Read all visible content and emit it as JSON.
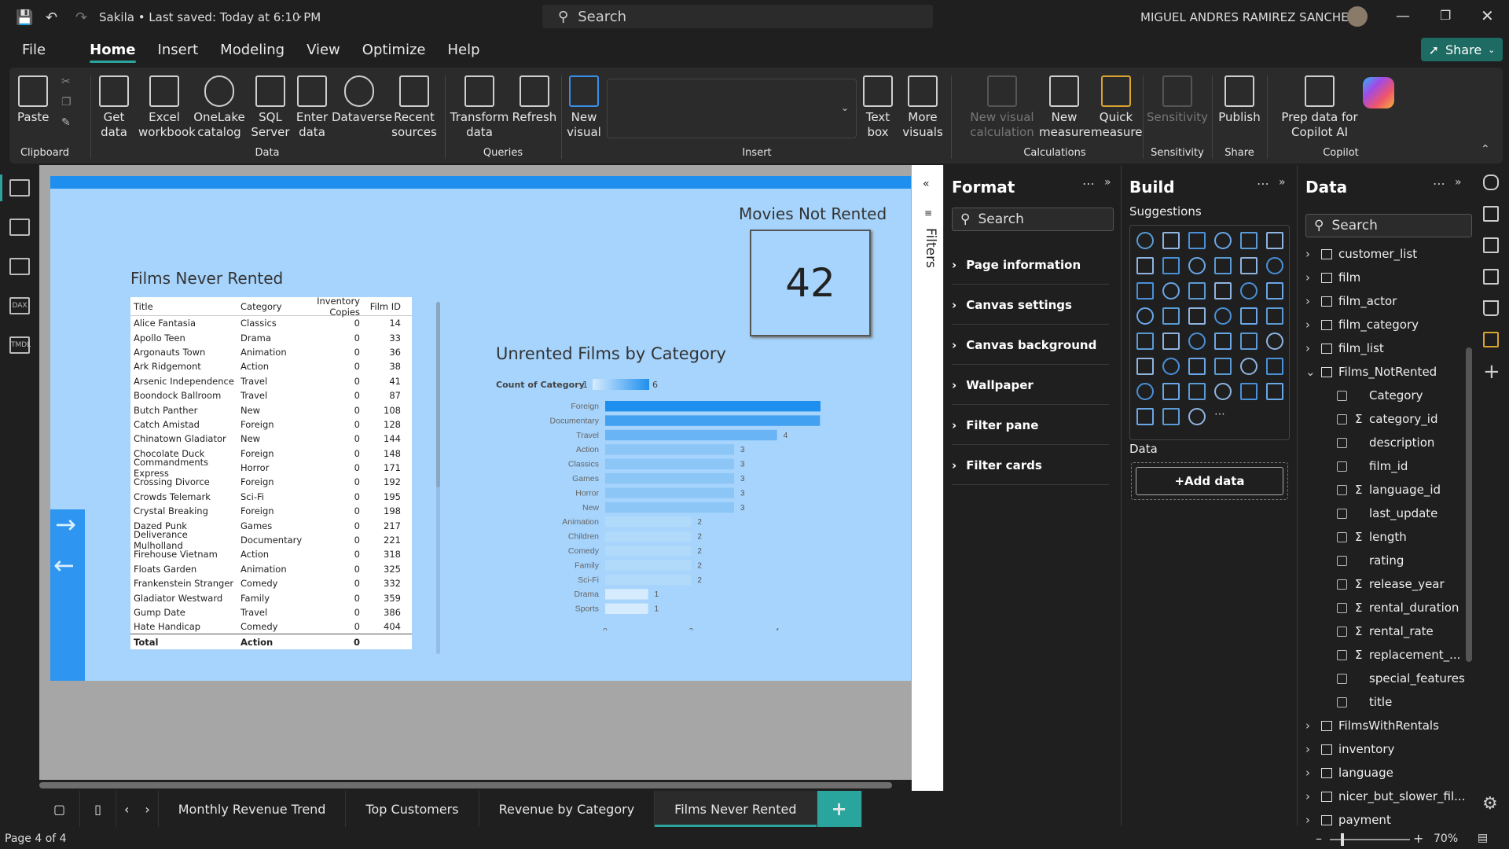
{
  "titlebar": {
    "title": "Sakila • Last saved: Today at 6:10 PM",
    "search": "Search",
    "user": "MIGUEL ANDRES RAMIREZ SANCHEZ"
  },
  "menu": [
    "File",
    "Home",
    "Insert",
    "Modeling",
    "View",
    "Optimize",
    "Help"
  ],
  "share": "Share",
  "ribbon": {
    "paste": "Paste",
    "get_data": "Get data",
    "excel": "Excel workbook",
    "onelake": "OneLake catalog",
    "sql": "SQL Server",
    "enter_data": "Enter data",
    "dataverse": "Dataverse",
    "recent": "Recent sources",
    "transform": "Transform data",
    "refresh": "Refresh",
    "new_visual": "New visual",
    "text_box": "Text box",
    "more_visuals": "More visuals",
    "new_visual_calc": "New visual calculation",
    "new_measure": "New measure",
    "quick_measure": "Quick measure",
    "sensitivity": "Sensitivity",
    "publish": "Publish",
    "prep_copilot": "Prep data for Copilot AI",
    "copilot": "Copilot",
    "groups": {
      "clipboard": "Clipboard",
      "data": "Data",
      "queries": "Queries",
      "insert": "Insert",
      "calculations": "Calculations",
      "sensitivity": "Sensitivity",
      "share": "Share",
      "copilot": "Copilot"
    }
  },
  "report": {
    "card_title": "Movies Not Rented",
    "card_value": "42",
    "table_title": "Films Never Rented",
    "table_headers": [
      "Title",
      "Category",
      "Inventory Copies",
      "Film ID"
    ],
    "table_rows": [
      [
        "Alice Fantasia",
        "Classics",
        "0",
        "14"
      ],
      [
        "Apollo Teen",
        "Drama",
        "0",
        "33"
      ],
      [
        "Argonauts Town",
        "Animation",
        "0",
        "36"
      ],
      [
        "Ark Ridgemont",
        "Action",
        "0",
        "38"
      ],
      [
        "Arsenic Independence",
        "Travel",
        "0",
        "41"
      ],
      [
        "Boondock Ballroom",
        "Travel",
        "0",
        "87"
      ],
      [
        "Butch Panther",
        "New",
        "0",
        "108"
      ],
      [
        "Catch Amistad",
        "Foreign",
        "0",
        "128"
      ],
      [
        "Chinatown Gladiator",
        "New",
        "0",
        "144"
      ],
      [
        "Chocolate Duck",
        "Foreign",
        "0",
        "148"
      ],
      [
        "Commandments Express",
        "Horror",
        "0",
        "171"
      ],
      [
        "Crossing Divorce",
        "Foreign",
        "0",
        "192"
      ],
      [
        "Crowds Telemark",
        "Sci-Fi",
        "0",
        "195"
      ],
      [
        "Crystal Breaking",
        "Foreign",
        "0",
        "198"
      ],
      [
        "Dazed Punk",
        "Games",
        "0",
        "217"
      ],
      [
        "Deliverance Mulholland",
        "Documentary",
        "0",
        "221"
      ],
      [
        "Firehouse Vietnam",
        "Action",
        "0",
        "318"
      ],
      [
        "Floats Garden",
        "Animation",
        "0",
        "325"
      ],
      [
        "Frankenstein Stranger",
        "Comedy",
        "0",
        "332"
      ],
      [
        "Gladiator Westward",
        "Family",
        "0",
        "359"
      ],
      [
        "Gump Date",
        "Travel",
        "0",
        "386"
      ],
      [
        "Hate Handicap",
        "Comedy",
        "0",
        "404"
      ]
    ],
    "table_total": [
      "Total",
      "Action",
      "0"
    ],
    "chart_title": "Unrented Films by Category",
    "legend_label": "Count of Category",
    "legend_min": "1",
    "legend_max": "6"
  },
  "chart_data": {
    "type": "bar",
    "orientation": "horizontal",
    "title": "Unrented Films by Category",
    "categories": [
      "Foreign",
      "Documentary",
      "Travel",
      "Action",
      "Classics",
      "Games",
      "Horror",
      "New",
      "Animation",
      "Children",
      "Comedy",
      "Family",
      "Sci-Fi",
      "Drama",
      "Sports"
    ],
    "values": [
      6,
      5,
      4,
      3,
      3,
      3,
      3,
      3,
      2,
      2,
      2,
      2,
      2,
      1,
      1
    ],
    "xticks": [
      "0",
      "2",
      "4",
      "6"
    ],
    "xlim": [
      0,
      6
    ],
    "color_scale": [
      "#d6ebfd",
      "#1e8fee"
    ]
  },
  "tabs": [
    "Monthly Revenue Trend",
    "Top Customers",
    "Revenue by Category",
    "Films Never Rented"
  ],
  "status": {
    "page": "Page 4 of 4",
    "zoom": "70%"
  },
  "filters_label": "Filters",
  "format_pane": {
    "title": "Format",
    "search": "Search",
    "items": [
      "Page information",
      "Canvas settings",
      "Canvas background",
      "Wallpaper",
      "Filter pane",
      "Filter cards"
    ]
  },
  "build_pane": {
    "title": "Build",
    "suggestions": "Suggestions",
    "data_label": "Data",
    "add_data": "+Add data"
  },
  "data_pane": {
    "title": "Data",
    "search": "Search",
    "tables": [
      "customer_list",
      "film",
      "film_actor",
      "film_category",
      "film_list",
      "Films_NotRented"
    ],
    "fields": [
      {
        "name": "Category",
        "sigma": false
      },
      {
        "name": "category_id",
        "sigma": true
      },
      {
        "name": "description",
        "sigma": false
      },
      {
        "name": "film_id",
        "sigma": false
      },
      {
        "name": "language_id",
        "sigma": true
      },
      {
        "name": "last_update",
        "sigma": false
      },
      {
        "name": "length",
        "sigma": true
      },
      {
        "name": "rating",
        "sigma": false
      },
      {
        "name": "release_year",
        "sigma": true
      },
      {
        "name": "rental_duration",
        "sigma": true
      },
      {
        "name": "rental_rate",
        "sigma": true
      },
      {
        "name": "replacement_...",
        "sigma": true
      },
      {
        "name": "special_features",
        "sigma": false
      },
      {
        "name": "title",
        "sigma": false
      }
    ],
    "tables_after": [
      "FilmsWithRentals",
      "inventory",
      "language",
      "nicer_but_slower_fil...",
      "payment"
    ]
  }
}
